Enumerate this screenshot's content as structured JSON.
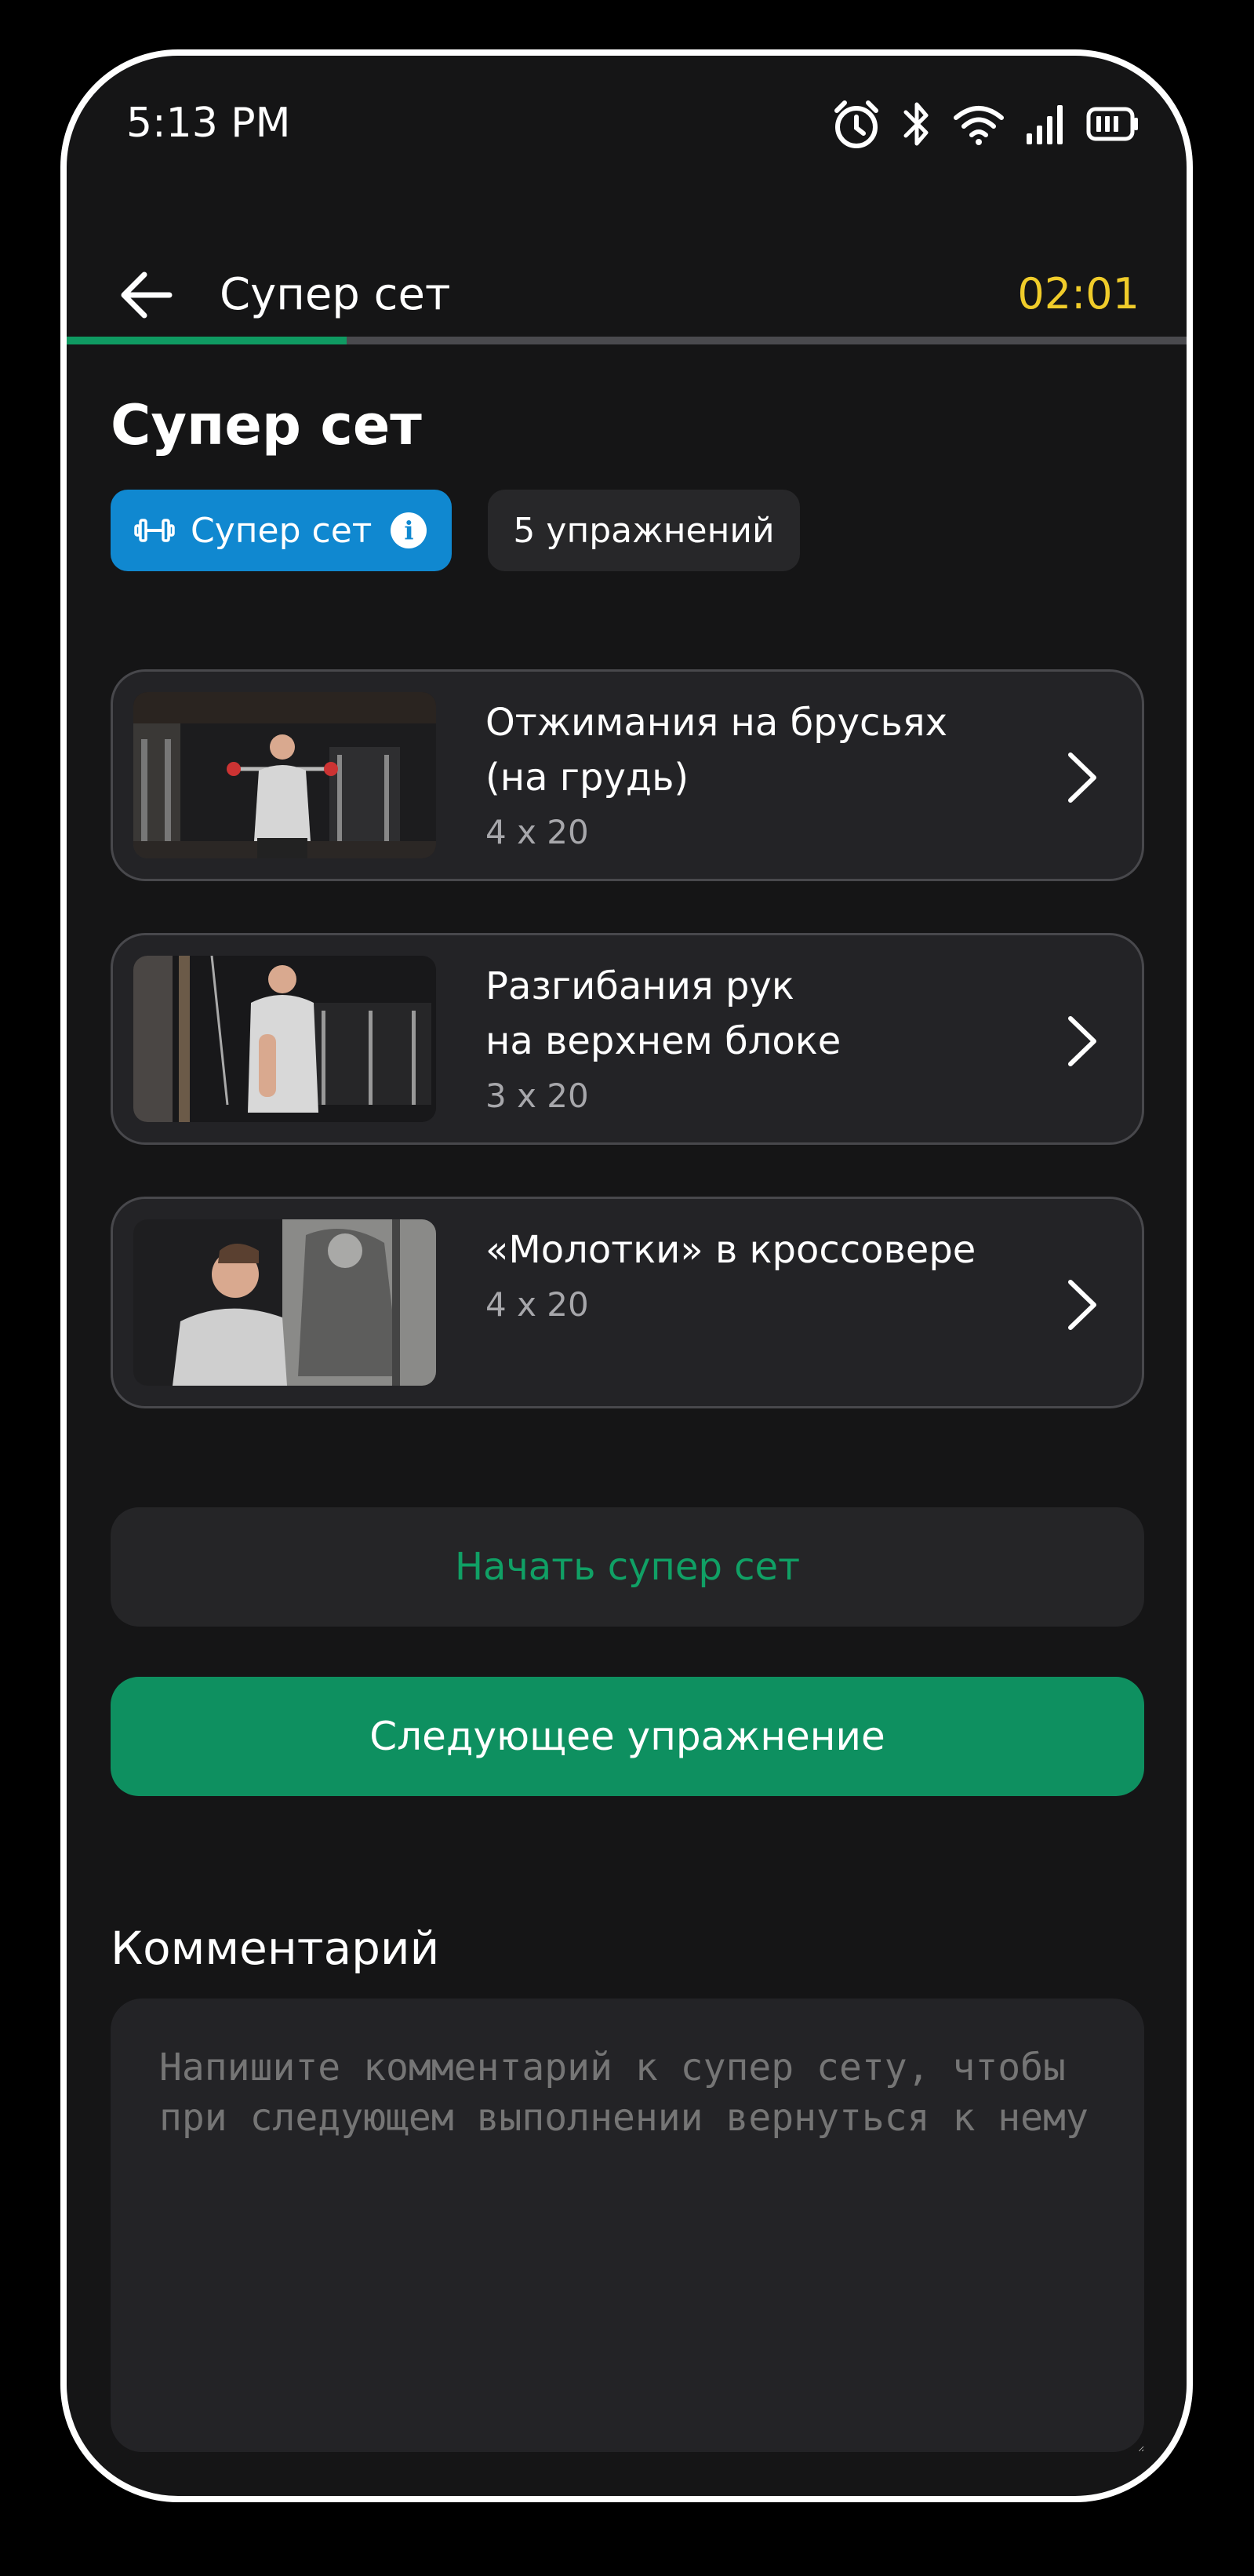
{
  "status_bar": {
    "time": "5:13 PM",
    "icons": [
      "alarm-icon",
      "bluetooth-icon",
      "wifi-icon",
      "signal-icon",
      "battery-icon"
    ]
  },
  "app_bar": {
    "title": "Супер сет",
    "timer": "02:01",
    "progress_fraction": 0.25
  },
  "page": {
    "title": "Супер сет",
    "chips": {
      "type_label": "Супер сет",
      "count_label": "5 упражнений"
    }
  },
  "exercises": [
    {
      "name": "Отжимания на брусьях\n(на грудь)",
      "sets": "4 x 20"
    },
    {
      "name": "Разгибания рук\nна верхнем блоке",
      "sets": "3 x 20"
    },
    {
      "name": "«Молотки» в кроссовере",
      "sets": "4 x 20"
    }
  ],
  "buttons": {
    "start_label": "Начать супер сет",
    "next_label": "Следующее упражнение"
  },
  "comment": {
    "label": "Комментарий",
    "placeholder": "Напишите комментарий к супер сету, чтобы при следующем выполнении вернуться к нему"
  },
  "colors": {
    "accent_green": "#0e9060",
    "chip_blue": "#1088d0",
    "timer_yellow": "#f0cc2a",
    "background": "#151516"
  }
}
